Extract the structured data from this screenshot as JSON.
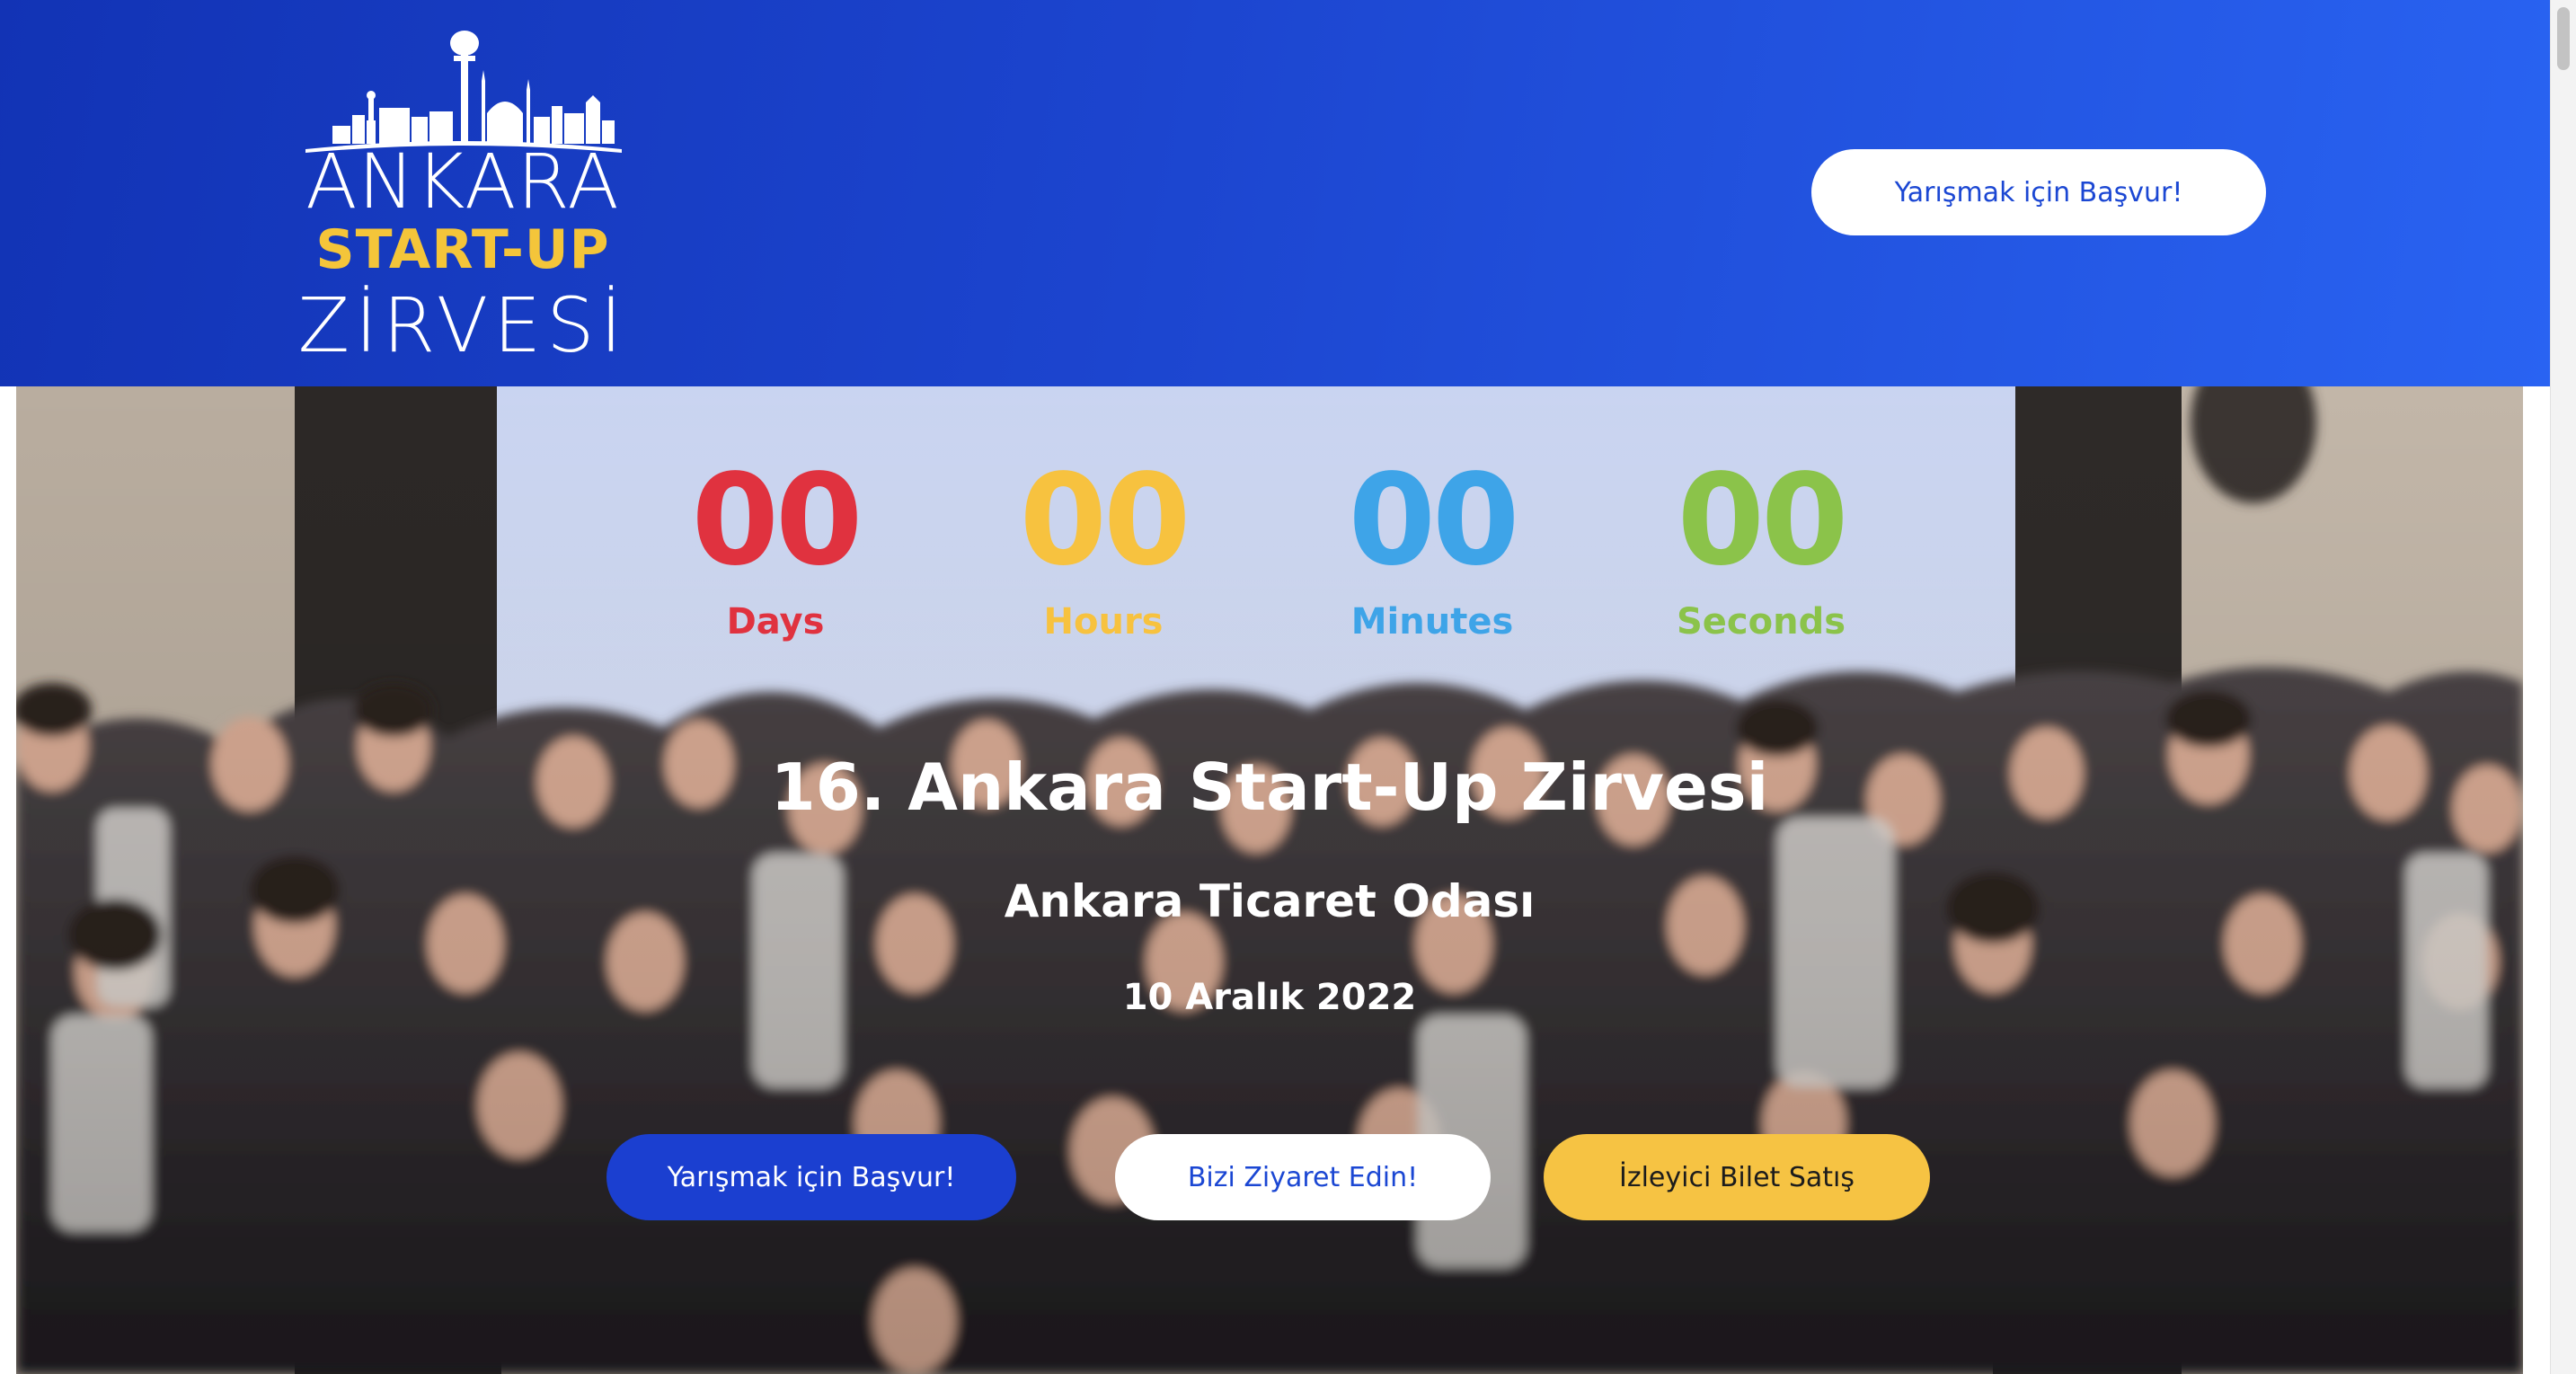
{
  "header": {
    "logo": {
      "line1": "ANKARA",
      "line2": "START-UP",
      "line3": "ZİRVESİ"
    },
    "cta_label": "Yarışmak için Başvur!"
  },
  "colors": {
    "header_blue_dark": "#1233b5",
    "header_blue_light": "#2963f2",
    "logo_yellow": "#f4c53a",
    "days": "#e0323f",
    "hours": "#f7c23f",
    "minutes": "#3ea4e8",
    "seconds": "#8bc34a",
    "ticket_yellow": "#f6c343"
  },
  "countdown": [
    {
      "value": "00",
      "label": "Days"
    },
    {
      "value": "00",
      "label": "Hours"
    },
    {
      "value": "00",
      "label": "Minutes"
    },
    {
      "value": "00",
      "label": "Seconds"
    }
  ],
  "hero": {
    "title": "16. Ankara Start-Up Zirvesi",
    "venue": "Ankara Ticaret Odası",
    "date": "10 Aralık 2022",
    "buttons": {
      "apply": "Yarışmak için Başvur!",
      "visit": "Bizi Ziyaret Edin!",
      "ticket": "İzleyici Bilet Satış"
    }
  }
}
